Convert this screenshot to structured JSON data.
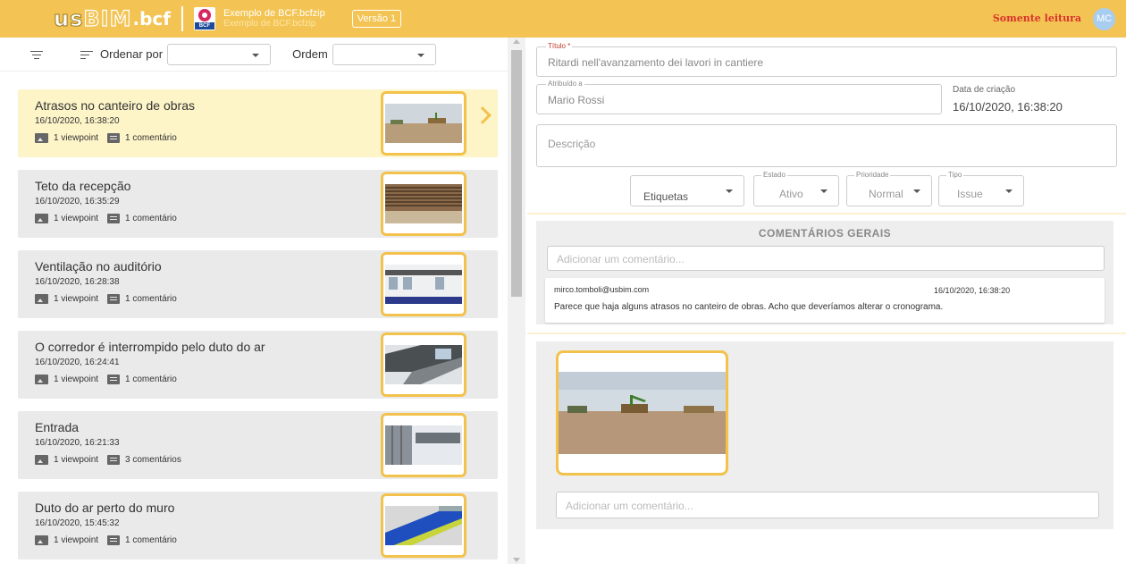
{
  "header": {
    "logo_us": "us",
    "logo_bim": "BIM",
    "logo_bcf": ".bcf",
    "file_ext": "BCF",
    "file_title": "Exemplo de BCF.bcfzip",
    "file_subtitle": "Exemplo de BCF.bcfzip",
    "version": "Versão 1",
    "readonly": "Somente leitura",
    "avatar": "MC",
    "accent_color": "#f3c453"
  },
  "toolbar": {
    "sort_label": "Ordenar por",
    "sort_value": "",
    "order_label": "Ordem",
    "order_value": ""
  },
  "issues": [
    {
      "title": "Atrasos no canteiro de obras",
      "date": "16/10/2020, 16:38:20",
      "viewpoints": "1 viewpoint",
      "comments": "1 comentário",
      "selected": true
    },
    {
      "title": "Teto da recepção",
      "date": "16/10/2020, 16:35:29",
      "viewpoints": "1 viewpoint",
      "comments": "1 comentário"
    },
    {
      "title": "Ventilação no auditório",
      "date": "16/10/2020, 16:28:38",
      "viewpoints": "1 viewpoint",
      "comments": "1 comentário"
    },
    {
      "title": "O corredor é interrompido pelo duto do ar",
      "date": "16/10/2020, 16:24:41",
      "viewpoints": "1 viewpoint",
      "comments": "1 comentário"
    },
    {
      "title": "Entrada",
      "date": "16/10/2020, 16:21:33",
      "viewpoints": "1 viewpoint",
      "comments": "3 comentários"
    },
    {
      "title": "Duto do ar perto do muro",
      "date": "16/10/2020, 15:45:32",
      "viewpoints": "1 viewpoint",
      "comments": "1 comentário"
    }
  ],
  "detail": {
    "title_label": "Título *",
    "title_value": "Ritardi nell'avanzamento dei lavori in cantiere",
    "assigned_label": "Atribuído a",
    "assigned_value": "Mario Rossi",
    "created_label": "Data de criação",
    "created_value": "16/10/2020, 16:38:20",
    "description_placeholder": "Descrição",
    "tags_value": "Etiquetas",
    "status_label": "Estado",
    "status_value": "Ativo",
    "priority_label": "Prioridade",
    "priority_value": "Normal",
    "type_label": "Tipo",
    "type_value": "Issue"
  },
  "comments": {
    "heading": "COMENTÁRIOS GERAIS",
    "input_placeholder": "Adicionar um comentário...",
    "items": [
      {
        "author": "mirco.tomboli@usbim.com",
        "date": "16/10/2020, 16:38:20",
        "text": "Parece que haja alguns atrasos no canteiro de obras. Acho que deveríamos alterar o cronograma."
      }
    ]
  },
  "viewpoint": {
    "input_placeholder": "Adicionar um comentário..."
  }
}
